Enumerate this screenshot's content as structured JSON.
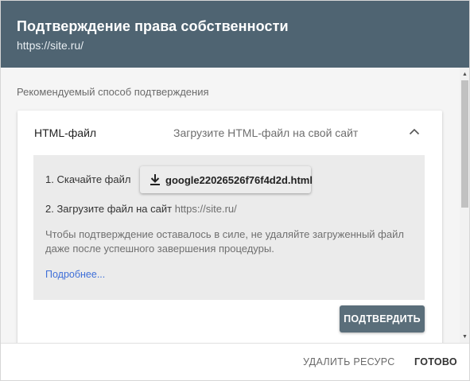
{
  "header": {
    "title": "Подтверждение права собственности",
    "subtitle": "https://site.ru/"
  },
  "content": {
    "section_label": "Рекомендуемый способ подтверждения",
    "card": {
      "method": "HTML-файл",
      "method_description": "Загрузите HTML-файл на свой сайт",
      "collapse_icon": "chevron-up-icon",
      "step1_label": "1. Скачайте файл",
      "download_file": "google22026526f76f4d2d.html",
      "download_icon": "download-icon",
      "step2_label": "2. Загрузите файл на сайт",
      "step2_site": "https://site.ru/",
      "note": "Чтобы подтверждение оставалось в силе, не удаляйте загруженный файл даже после успешного завершения процедуры.",
      "more_link": "Подробнее...",
      "confirm_button": "ПОДТВЕРДИТЬ"
    }
  },
  "footer": {
    "delete_button": "УДАЛИТЬ РЕСУРС",
    "done_button": "ГОТОВО"
  },
  "colors": {
    "header_bg": "#4f6472",
    "confirm_bg": "#5a6e7a",
    "link": "#3f6fd8"
  }
}
